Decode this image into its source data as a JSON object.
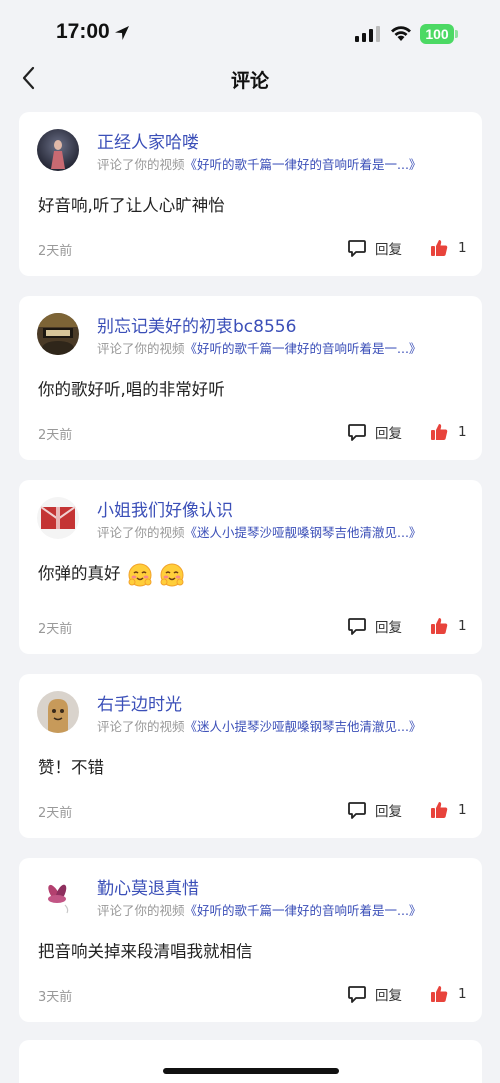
{
  "status_bar": {
    "time": "17:00",
    "battery": "100"
  },
  "nav": {
    "title": "评论",
    "back_icon": "chevron-left-icon"
  },
  "sub_prefix": "评论了你的视频",
  "comments": [
    {
      "username": "正经人家哈喽",
      "video": "《好听的歌千篇一律好的音响听着是一...》",
      "text": "好音响,听了让人心旷神怡",
      "time": "2天前",
      "reply_label": "回复",
      "likes": "1",
      "avatar": "dark-figure"
    },
    {
      "username": "别忘记美好的初衷bc8556",
      "video": "《好听的歌千篇一律好的音响听着是一...》",
      "text": "你的歌好听,唱的非常好听",
      "time": "2天前",
      "reply_label": "回复",
      "likes": "1",
      "avatar": "banner"
    },
    {
      "username": "小姐我们好像认识",
      "video": "《迷人小提琴沙哑靓嗓钢琴吉他清澈见...》",
      "text": "你弹的真好",
      "time": "2天前",
      "reply_label": "回复",
      "likes": "1",
      "avatar": "red-gift",
      "emoji": "blush-emoji"
    },
    {
      "username": "右手边时光",
      "video": "《迷人小提琴沙哑靓嗓钢琴吉他清澈见...》",
      "text": "赞！不错",
      "time": "2天前",
      "reply_label": "回复",
      "likes": "1",
      "avatar": "cartoon"
    },
    {
      "username": "勤心莫退真惜",
      "video": "《好听的歌千篇一律好的音响听着是一...》",
      "text": "把音响关掉来段清唱我就相信",
      "time": "3天前",
      "reply_label": "回复",
      "likes": "1",
      "avatar": "flower"
    }
  ],
  "colors": {
    "link": "#3b4fb8",
    "like": "#e8433b",
    "background": "#f2f3f6",
    "battery": "#4cd964"
  }
}
